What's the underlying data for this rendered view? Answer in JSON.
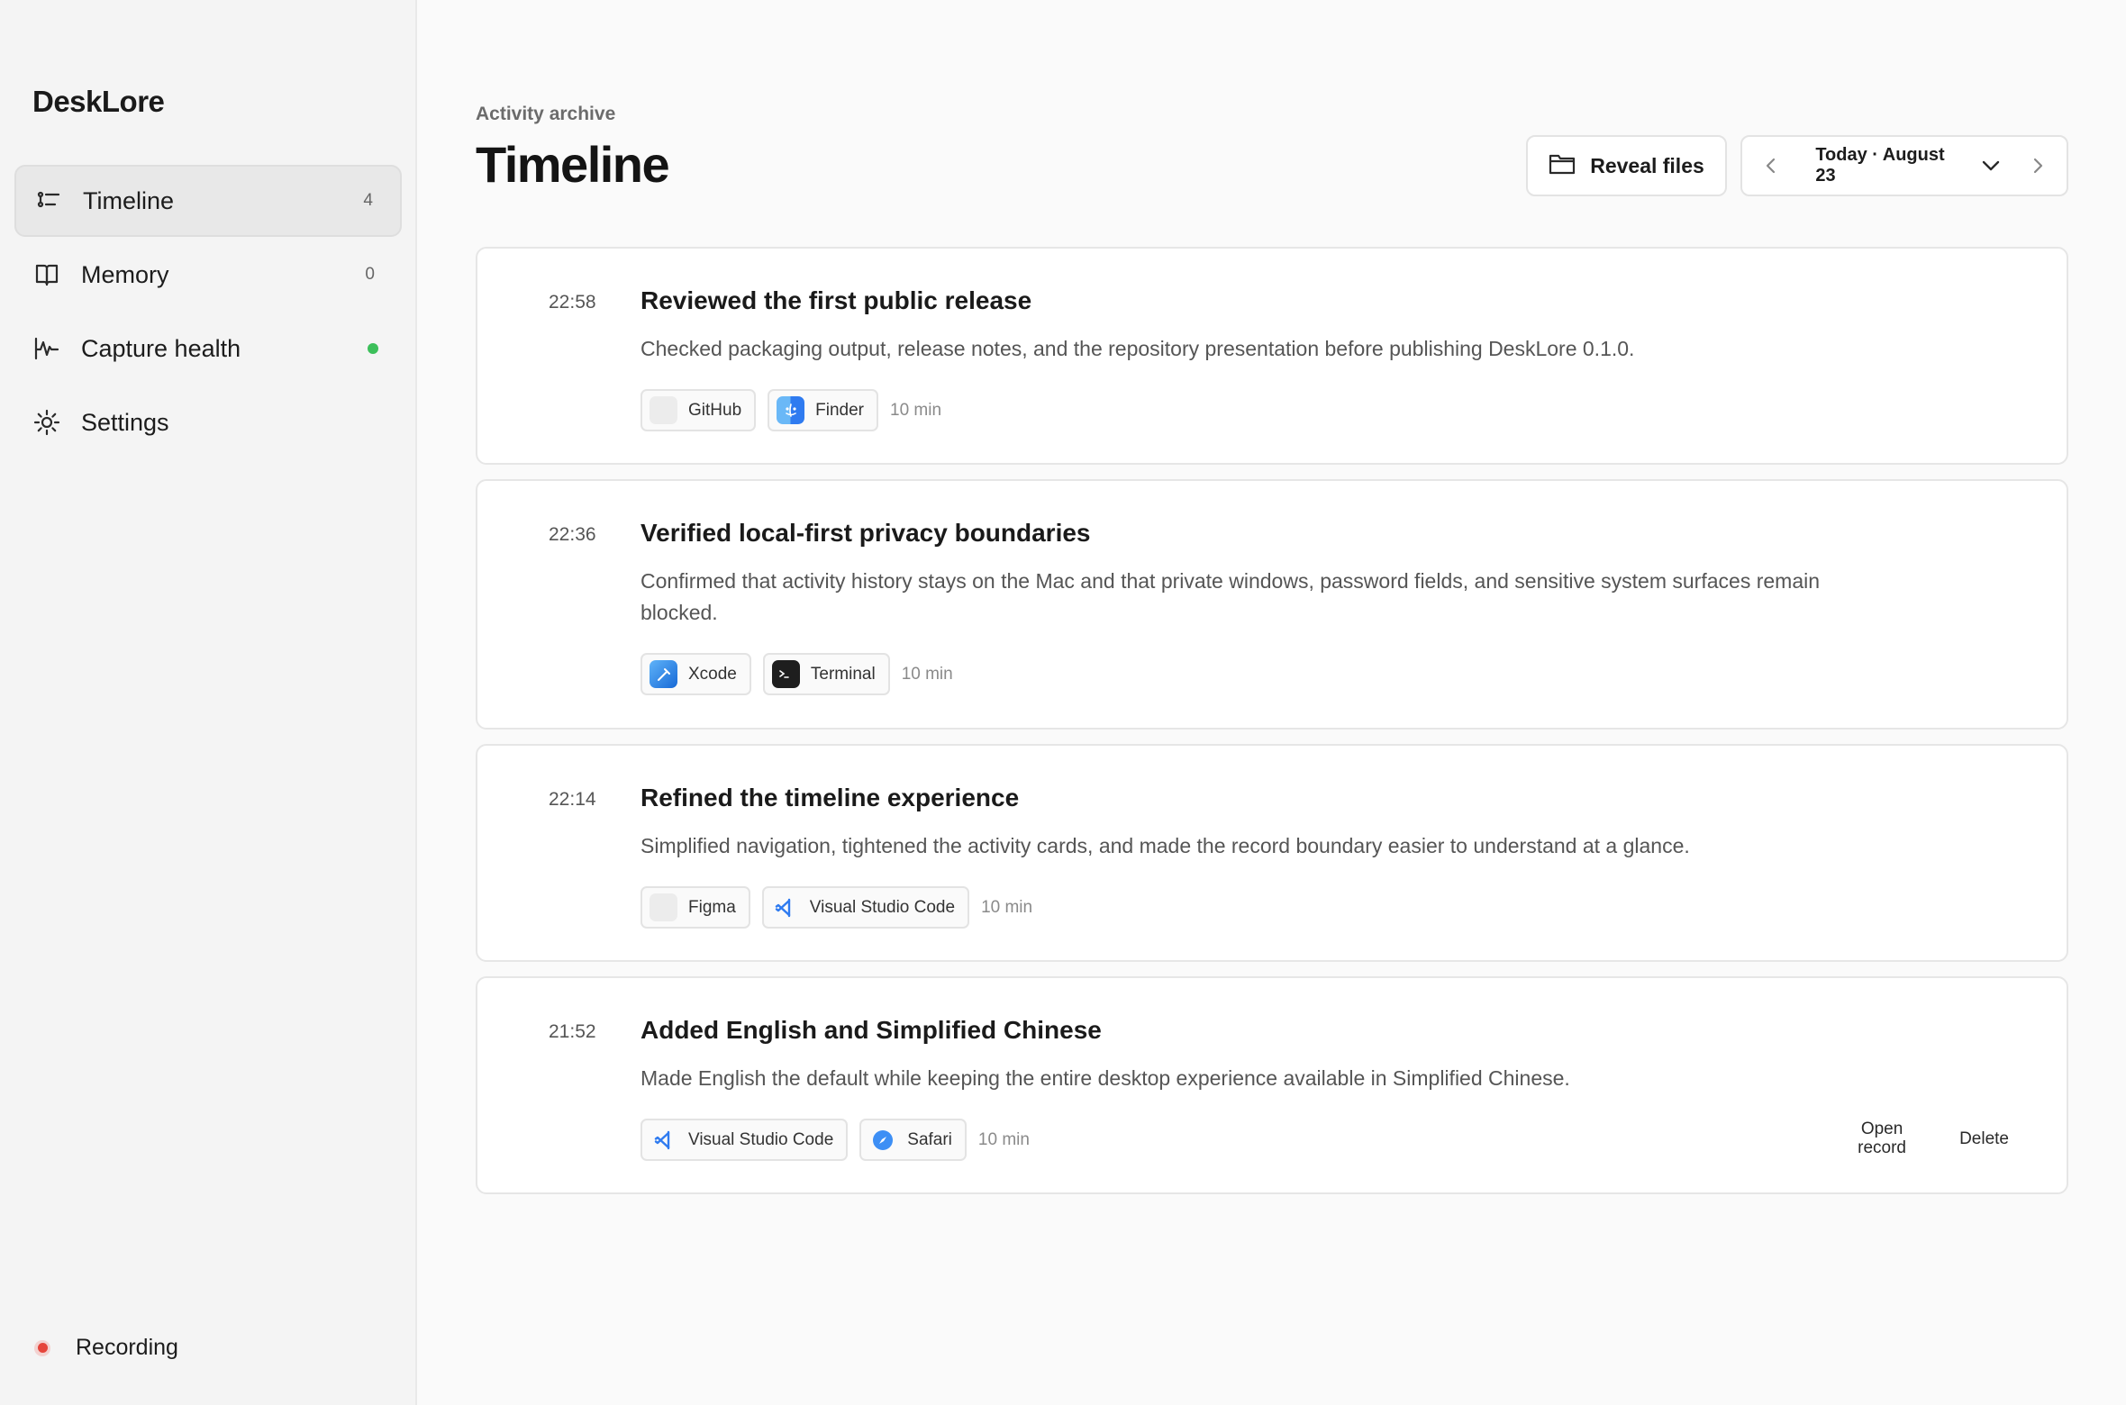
{
  "sidebar": {
    "brand": "DeskLore",
    "items": [
      {
        "label": "Timeline",
        "count": "4",
        "icon": "list-icon"
      },
      {
        "label": "Memory",
        "count": "0",
        "icon": "book-icon"
      },
      {
        "label": "Capture health",
        "status": "ok",
        "icon": "pulse-icon"
      },
      {
        "label": "Settings",
        "icon": "gear-icon"
      }
    ],
    "recording": "Recording"
  },
  "header": {
    "eyebrow": "Activity archive",
    "title": "Timeline",
    "reveal_label": "Reveal files",
    "date_label": "Today · August 23"
  },
  "entries": [
    {
      "time": "22:58",
      "title": "Reviewed the first public release",
      "description": "Checked packaging output, release notes, and the repository presentation before publishing DeskLore 0.1.0.",
      "apps": [
        "GitHub",
        "Finder"
      ],
      "duration": "10 min"
    },
    {
      "time": "22:36",
      "title": "Verified local-first privacy boundaries",
      "description": "Confirmed that activity history stays on the Mac and that private windows, password fields, and sensitive system surfaces remain blocked.",
      "apps": [
        "Xcode",
        "Terminal"
      ],
      "duration": "10 min"
    },
    {
      "time": "22:14",
      "title": "Refined the timeline experience",
      "description": "Simplified navigation, tightened the activity cards, and made the record boundary easier to understand at a glance.",
      "apps": [
        "Figma",
        "Visual Studio Code"
      ],
      "duration": "10 min"
    },
    {
      "time": "21:52",
      "title": "Added English and Simplified Chinese",
      "description": "Made English the default while keeping the entire desktop experience available in Simplified Chinese.",
      "apps": [
        "Visual Studio Code",
        "Safari"
      ],
      "duration": "10 min",
      "actions": {
        "open": "Open record",
        "delete": "Delete"
      }
    }
  ],
  "colors": {
    "status_ok": "#3cbf5a",
    "recording": "#e5453b",
    "accent_blue": "#2f7bf0"
  }
}
